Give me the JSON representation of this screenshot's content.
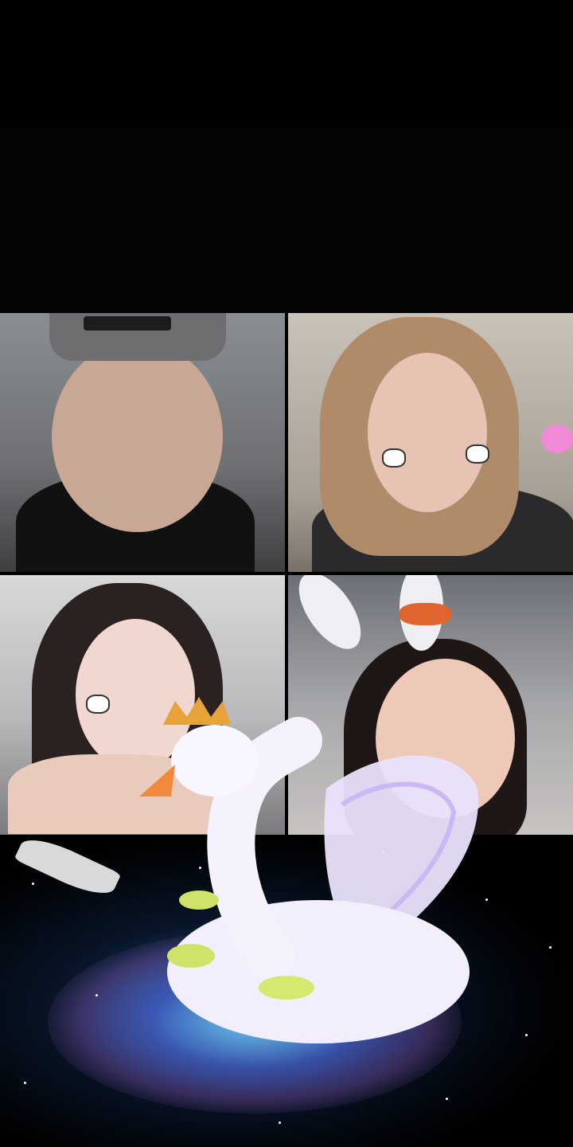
{
  "call": {
    "participants": [
      {
        "id": 1,
        "effect": "none"
      },
      {
        "id": 2,
        "effect": "cat-cheek-stickers"
      },
      {
        "id": 3,
        "effect": "cat-cheek-stickers"
      },
      {
        "id": 4,
        "effect": "bunny-ears"
      }
    ]
  },
  "gift_effect": {
    "name": "swan-gift-animation",
    "colors": {
      "swan": "#f3eefc",
      "crown": "#e7a23a",
      "beak": "#f08a3a",
      "glow": "#7fd9ff"
    }
  }
}
